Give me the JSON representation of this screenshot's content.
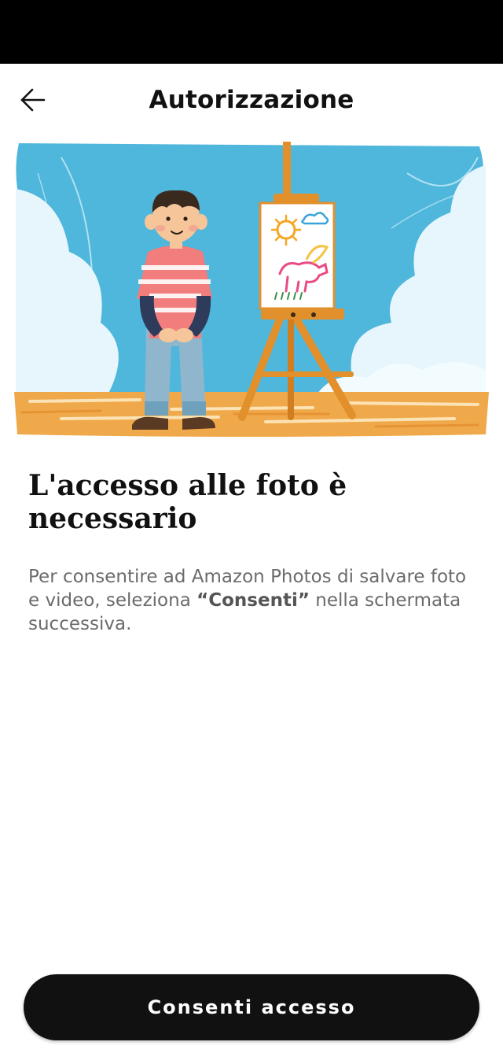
{
  "header": {
    "title": "Autorizzazione",
    "back_icon": "arrow-left-icon"
  },
  "hero": {
    "illustration": "child-with-easel-illustration"
  },
  "content": {
    "headline": "L'accesso alle foto è necessario",
    "description_before": "Per consentire ad Amazon Photos di salvare foto e video, seleziona ",
    "description_emphasis": "“Consenti”",
    "description_after": " nella schermata successiva."
  },
  "actions": {
    "primary_label": "Consenti accesso"
  },
  "colors": {
    "status_bar": "#000000",
    "button_bg": "#111111",
    "button_text": "#ffffff",
    "sky": "#4fb6dc",
    "floor": "#f0a94a"
  }
}
